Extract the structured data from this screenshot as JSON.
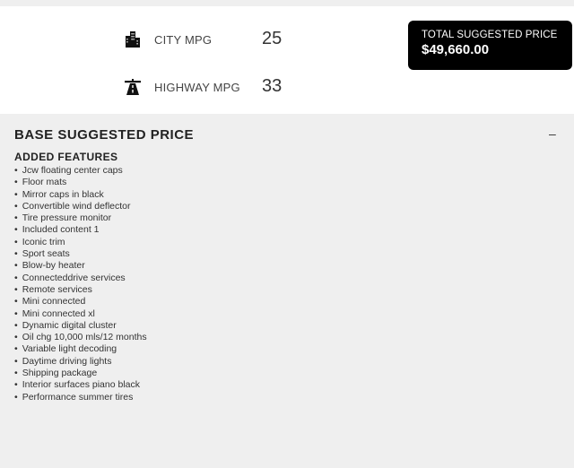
{
  "mpg": {
    "city": {
      "icon": "city-buildings-icon",
      "label": "CITY MPG",
      "value": "25"
    },
    "highway": {
      "icon": "highway-road-icon",
      "label": "HIGHWAY MPG",
      "value": "33"
    }
  },
  "total_price": {
    "label": "TOTAL SUGGESTED PRICE",
    "value": "$49,660.00"
  },
  "base_panel": {
    "title": "BASE SUGGESTED PRICE",
    "collapse_label": "–",
    "features_title": "ADDED FEATURES",
    "features": [
      "Jcw floating center caps",
      "Floor mats",
      "Mirror caps in black",
      "Convertible wind deflector",
      "Tire pressure monitor",
      "Included content 1",
      "Iconic trim",
      "Sport seats",
      "Blow-by heater",
      "Connecteddrive services",
      "Remote services",
      "Mini connected",
      "Mini connected xl",
      "Dynamic digital cluster",
      "Oil chg 10,000 mls/12 months",
      "Variable light decoding",
      "Daytime driving lights",
      "Shipping package",
      "Interior surfaces piano black",
      "Performance summer tires"
    ]
  },
  "colors": {
    "price_box_bg": "#000000",
    "panel_bg": "#efefef"
  }
}
